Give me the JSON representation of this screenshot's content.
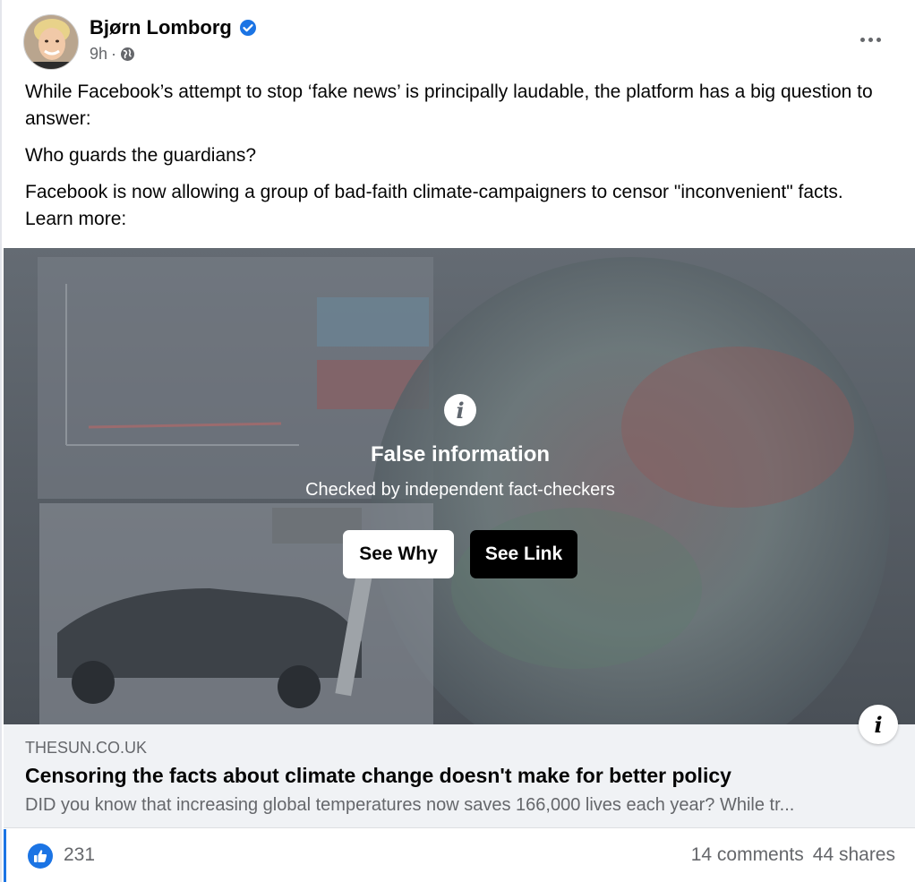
{
  "post": {
    "author": "Bjørn Lomborg",
    "time": "9h",
    "separator": "·",
    "paragraphs": [
      "While Facebook’s attempt to stop ‘fake news’ is principally laudable, the platform has a big question to answer:",
      "Who guards the guardians?",
      "Facebook is now allowing a group of bad-faith climate-campaigners to censor \"inconvenient\" facts. Learn more:"
    ]
  },
  "fact_check": {
    "title": "False information",
    "subtitle": "Checked by independent fact-checkers",
    "see_why": "See Why",
    "see_link": "See Link"
  },
  "link_preview": {
    "domain": "THESUN.CO.UK",
    "title": "Censoring the facts about climate change doesn't make for better policy",
    "description": "DID you know that increasing global temperatures now saves 166,000 lives each year? While tr..."
  },
  "engagement": {
    "likes": "231",
    "comments": "14 comments",
    "shares": "44 shares"
  },
  "icons": {
    "verified": "verified-badge-icon",
    "globe": "globe-icon",
    "more": "more-options-icon",
    "info": "info-icon",
    "like": "like-thumb-icon"
  },
  "colors": {
    "accent": "#1b74e4",
    "secondary_text": "#65676b",
    "preview_bg": "#f0f2f5"
  }
}
